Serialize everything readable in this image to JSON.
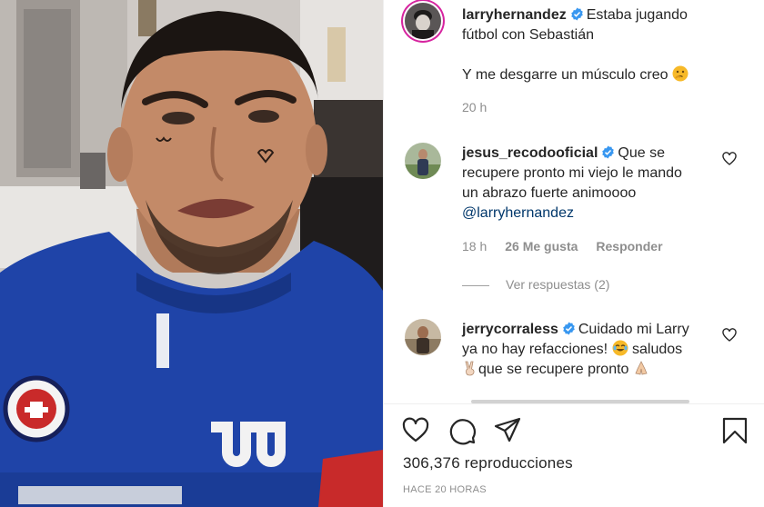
{
  "post": {
    "username": "larryhernandez",
    "caption_line1": "Estaba jugando",
    "caption_line2": "fútbol con Sebastián",
    "caption_line3": "Y me desgarre un músculo creo",
    "time": "20 h"
  },
  "comments": [
    {
      "username": "jesus_recodooficial",
      "text_line1": "Que se",
      "text_line2": "recupere pronto mi viejo le mando",
      "text_line3": "un abrazo fuerte animoooo",
      "mention": "@larryhernandez",
      "time": "18 h",
      "likes": "26 Me gusta",
      "reply_label": "Responder",
      "view_replies": "Ver respuestas (2)"
    },
    {
      "username": "jerrycorraless",
      "text_line1": "Cuidado mi Larry",
      "text_line2": "ya no hay refacciones!",
      "text_line2b": "saludos",
      "text_line3": "que se recupere pronto"
    }
  ],
  "stats": {
    "views": "306,376 reproducciones",
    "posted": "HACE 20 HORAS"
  },
  "icons": {
    "verified_color": "#3897f0",
    "like": "heart-icon",
    "comment": "comment-icon",
    "share": "share-icon",
    "save": "bookmark-icon"
  }
}
